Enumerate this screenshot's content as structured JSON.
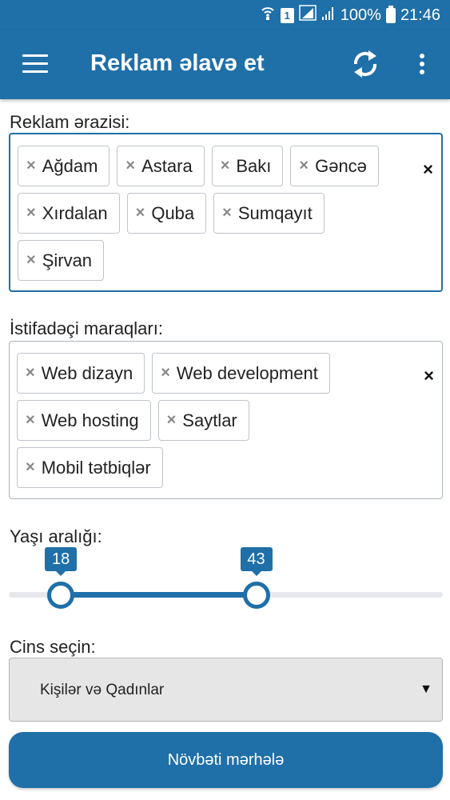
{
  "status_bar": {
    "sim_slot": "1",
    "battery": "100%",
    "time": "21:46",
    "icons": [
      "wifi-calling-icon",
      "sim-icon",
      "signal-icon",
      "signal-icon",
      "battery-icon"
    ]
  },
  "app_bar": {
    "title": "Reklam əlavə et",
    "icons": [
      "menu-icon",
      "refresh-icon",
      "more-vert-icon"
    ]
  },
  "region": {
    "label": "Reklam ərazisi:",
    "tags": [
      "Ağdam",
      "Astara",
      "Bakı",
      "Gəncə",
      "Xırdalan",
      "Quba",
      "Sumqayıt",
      "Şirvan"
    ],
    "remove_symbol": "×",
    "clear_symbol": "×"
  },
  "interests": {
    "label": "İstifadəçi maraqları:",
    "tags": [
      "Web dizayn",
      "Web development",
      "Web hosting",
      "Saytlar",
      "Mobil tətbiqlər"
    ],
    "remove_symbol": "×",
    "clear_symbol": "×"
  },
  "age_range": {
    "label": "Yaşı aralığı:",
    "min_value": "18",
    "max_value": "43",
    "min_fraction": 0.12,
    "max_fraction": 0.57
  },
  "gender": {
    "label": "Cins seçin:",
    "selected": "Kişilər və Qadınlar",
    "caret": "▼"
  },
  "next_button": {
    "label": "Növbəti mərhələ"
  },
  "colors": {
    "primary": "#1f6fa8",
    "track": "#e6e8ee",
    "select_bg": "#e6e6e6"
  }
}
